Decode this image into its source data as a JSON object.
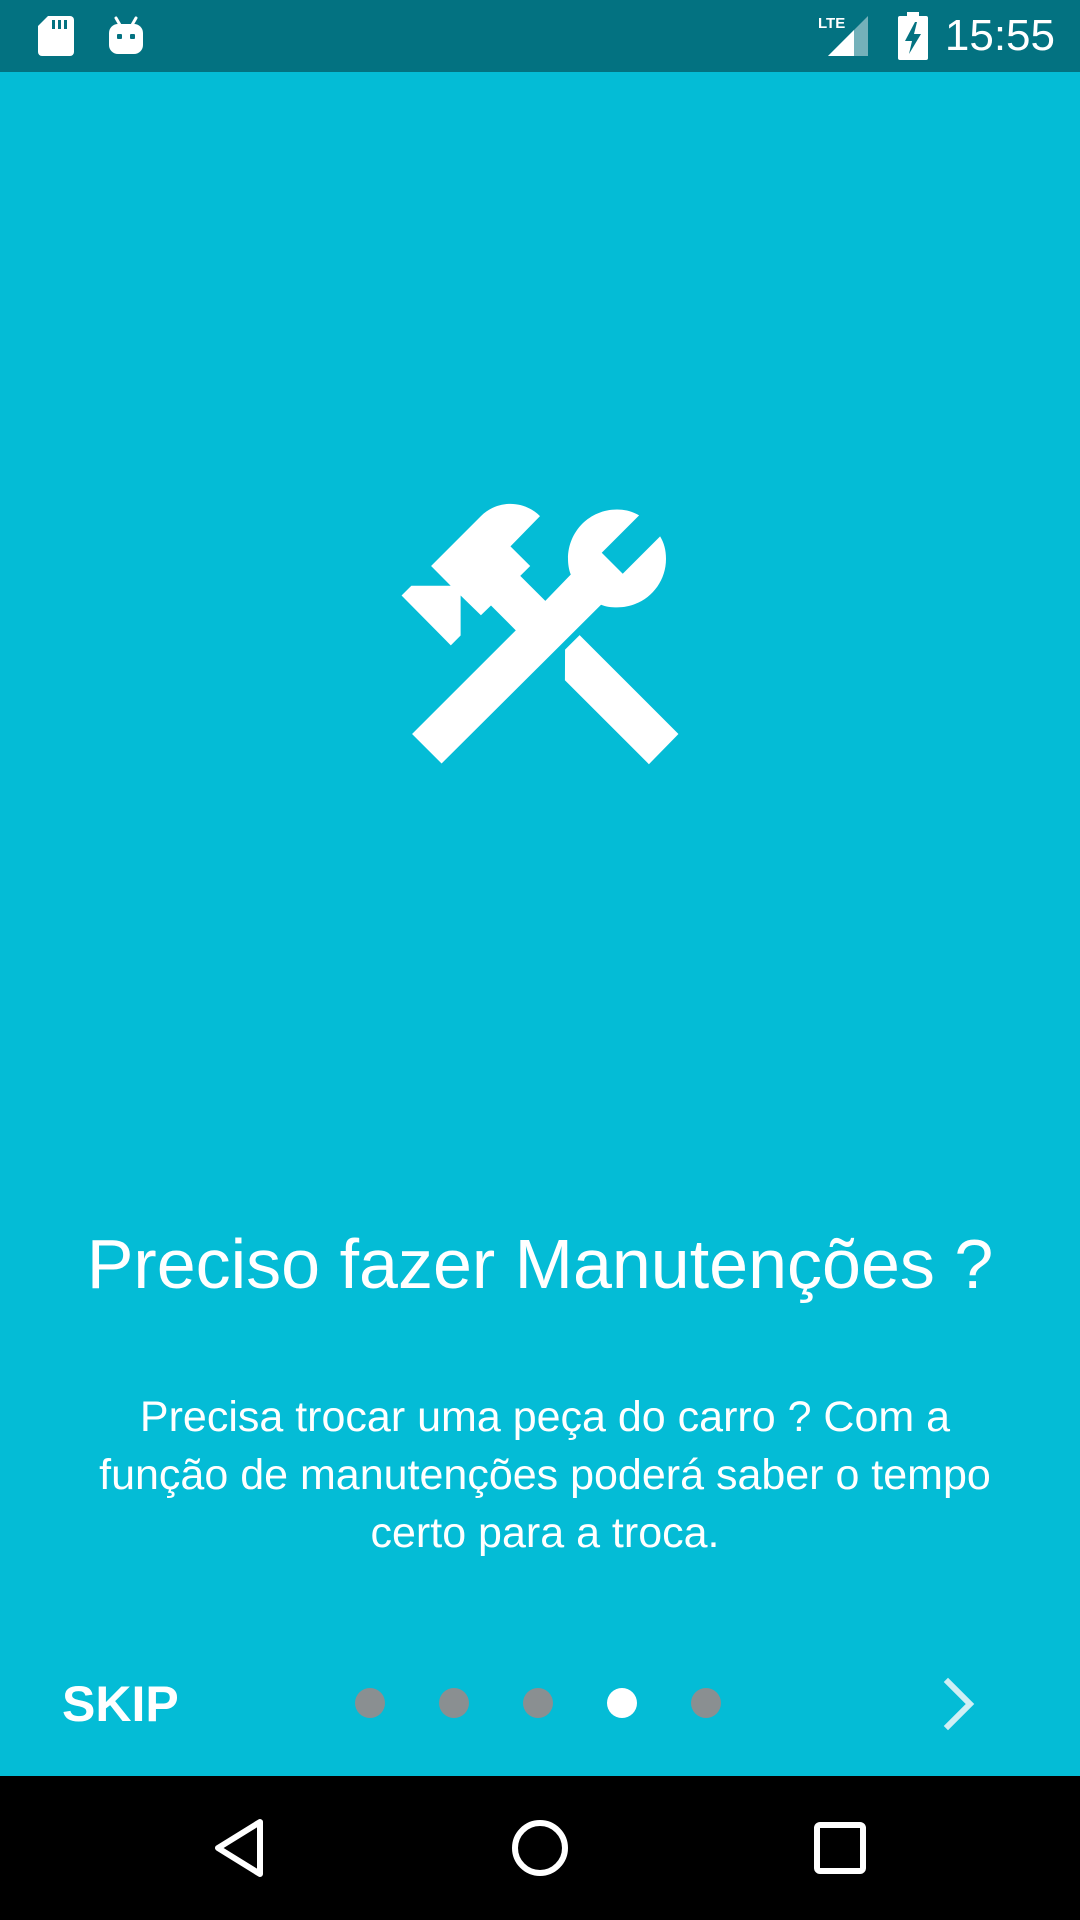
{
  "status_bar": {
    "time": "15:55",
    "network_label": "LTE",
    "icons": [
      "sd-card-icon",
      "android-debug-icon",
      "lte-signal-icon",
      "battery-charging-icon"
    ]
  },
  "slide": {
    "icon": "tools-hammer-wrench-icon",
    "title": "Preciso fazer Manutenções ?",
    "description": "Precisa trocar uma peça do carro ? Com a função de manutenções poderá saber o tempo certo para a troca."
  },
  "controls": {
    "skip_label": "SKIP",
    "page_count": 5,
    "current_page": 4,
    "next_icon": "chevron-right-icon"
  },
  "nav_bar": {
    "icons": [
      "back-icon",
      "home-icon",
      "recents-icon"
    ]
  },
  "colors": {
    "background": "#04bcd6",
    "status_bar": "#037281",
    "dot_inactive": "#8a8f91",
    "dot_active": "#ffffff"
  }
}
